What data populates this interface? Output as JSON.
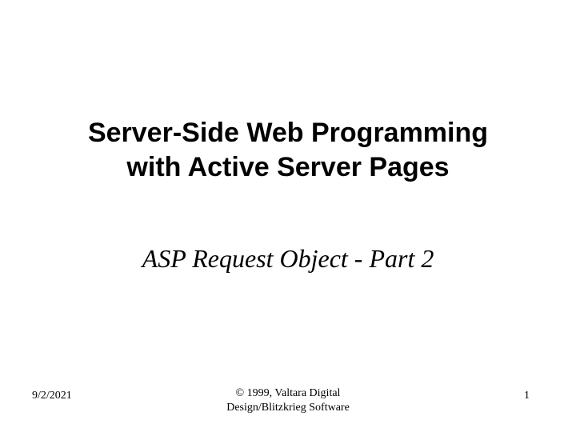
{
  "slide": {
    "title_line1": "Server-Side Web Programming",
    "title_line2": "with Active Server Pages",
    "subtitle": "ASP Request Object - Part 2"
  },
  "footer": {
    "date": "9/2/2021",
    "copyright_line1": "© 1999, Valtara Digital",
    "copyright_line2": "Design/Blitzkrieg Software",
    "page_number": "1"
  }
}
